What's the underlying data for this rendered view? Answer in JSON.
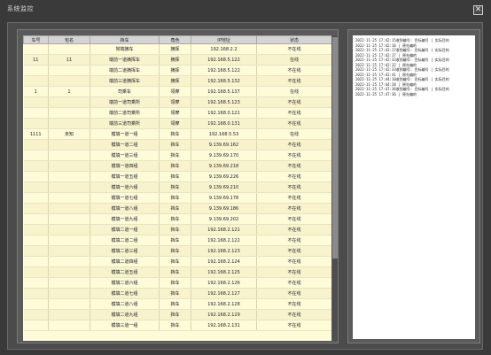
{
  "window": {
    "title": "系统监控"
  },
  "table": {
    "headers": [
      "车号",
      "包名",
      "挡车",
      "角色",
      "IP地址",
      "状态"
    ],
    "rows": [
      [
        "",
        "",
        "常端摘车",
        "摘挥",
        "192.168.2.2",
        "不在线"
      ],
      [
        "11",
        "11",
        "端前一道摘挥车",
        "摘挥",
        "192.168.5.122",
        "在线"
      ],
      [
        "",
        "",
        "端前二道摘挥车",
        "摘挥",
        "192.168.5.122",
        "不在线"
      ],
      [
        "",
        "",
        "端前三道摘挥车",
        "摘挥",
        "192.168.5.132",
        "不在线"
      ],
      [
        "1",
        "1",
        "司乘车",
        "领摩",
        "192.168.5.137",
        "在线"
      ],
      [
        "",
        "",
        "端前一道司乘所",
        "领摩",
        "192.168.5.123",
        "不在线"
      ],
      [
        "",
        "",
        "端前二道司乘所",
        "领摩",
        "192.168.0.121",
        "不在线"
      ],
      [
        "",
        "",
        "端前三道司乘所",
        "领摩",
        "192.168.0.131",
        "不在线"
      ],
      [
        "1111",
        "未知",
        "模填一道一组",
        "挡车",
        "192.168.5.53",
        "在线"
      ],
      [
        "",
        "",
        "模填一道二组",
        "挡车",
        "9.139.69.162",
        "不在线"
      ],
      [
        "",
        "",
        "模填一道三组",
        "挡车",
        "9.139.69.170",
        "不在线"
      ],
      [
        "",
        "",
        "模填一道四组",
        "挡车",
        "9.139.69.218",
        "不在线"
      ],
      [
        "",
        "",
        "模填一道五组",
        "挡车",
        "9.139.69.226",
        "不在线"
      ],
      [
        "",
        "",
        "模填一道六组",
        "挡车",
        "9.139.69.210",
        "不在线"
      ],
      [
        "",
        "",
        "模填一道七组",
        "挡车",
        "9.139.69.178",
        "不在线"
      ],
      [
        "",
        "",
        "模填一道八组",
        "挡车",
        "9.139.69.186",
        "不在线"
      ],
      [
        "",
        "",
        "模填一道九组",
        "挡车",
        "9.139.69.202",
        "不在线"
      ],
      [
        "",
        "",
        "模填二道一组",
        "挡车",
        "192.168.2.121",
        "不在线"
      ],
      [
        "",
        "",
        "模填二道二组",
        "挡车",
        "192.168.2.122",
        "不在线"
      ],
      [
        "",
        "",
        "模填二道三组",
        "挡车",
        "192.168.2.123",
        "不在线"
      ],
      [
        "",
        "",
        "模填二道四组",
        "挡车",
        "192.168.2.124",
        "不在线"
      ],
      [
        "",
        "",
        "模填二道五组",
        "挡车",
        "192.168.2.125",
        "不在线"
      ],
      [
        "",
        "",
        "模填二道六组",
        "挡车",
        "192.168.2.126",
        "不在线"
      ],
      [
        "",
        "",
        "模填二道七组",
        "挡车",
        "192.168.2.127",
        "不在线"
      ],
      [
        "",
        "",
        "模填二道八组",
        "挡车",
        "192.168.2.128",
        "不在线"
      ],
      [
        "",
        "",
        "模填二道九组",
        "挡车",
        "192.168.2.129",
        "不在线"
      ],
      [
        "",
        "",
        "模填三道一组",
        "挡车",
        "192.168.2.131",
        "不在线"
      ]
    ]
  },
  "log": [
    "2022-11-25 17:42:15收到编号: 目标编号  | 实际目的",
    "2022-11-25 17:42:16 | 原先编的",
    "2022-11-25 17:42:17收到编号: 目标编号  | 实际目的",
    "2022-11-25 17:42:17 | 原先编的",
    "2022-11-25 17:42:32收到编号: 目标编号  | 实际目的",
    "2022-11-25 17:42:32 | 原先编的",
    "2022-11-25 17:42:33收到编号: 目标编号  | 实际目的",
    "2022-11-25 17:42:41 | 原先编的",
    "2022-11-25 17:44:10收到编号: 目标编号  | 实际目的",
    "2022-11-25 17:44:28 | 原先编的",
    "2022-11-25 17:47:36收到编号: 目标编号  | 实际目的",
    "2022-11-25 17:47:36 | 原先编的"
  ],
  "icons": {
    "close": "close-icon"
  },
  "colors": {
    "table_bg": "#fdfbd8",
    "header_bg": "#d4d4d4",
    "frame": "#3a3a3a"
  }
}
